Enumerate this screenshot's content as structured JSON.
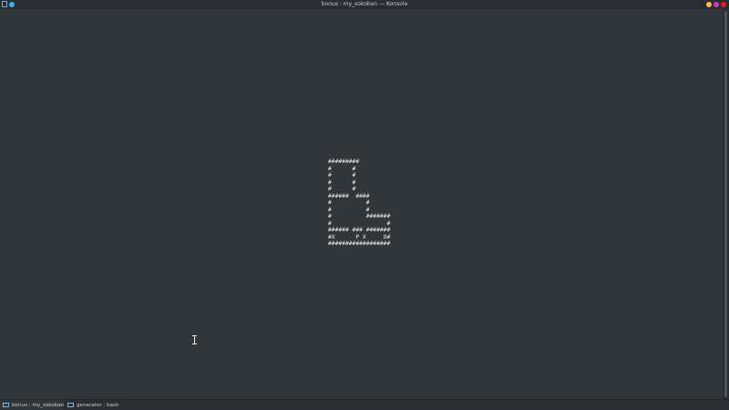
{
  "window": {
    "title": "bonus : my_sokoban — Konsole"
  },
  "terminal": {
    "game_board": "#########\n#      #\n#      #\n#      #\n#      #\n######  ####\n#          #\n#          #\n#          #######\n#                #\n###### ### #######\n#X      P X     O#\n##################"
  },
  "tabs": [
    {
      "label": "bonus : my_sokoban",
      "active": true
    },
    {
      "label": "generator : bash",
      "active": false
    }
  ],
  "colors": {
    "background": "#31363b",
    "titlebar": "#2a2e32",
    "accent": "#3daee9",
    "minimize": "#fdbc4b",
    "maximize": "#c838c6",
    "close": "#ed1515"
  },
  "icons": {
    "app": "terminal-icon",
    "pin": "pin-icon",
    "minimize": "minimize-icon",
    "maximize": "maximize-icon",
    "close": "close-icon"
  }
}
